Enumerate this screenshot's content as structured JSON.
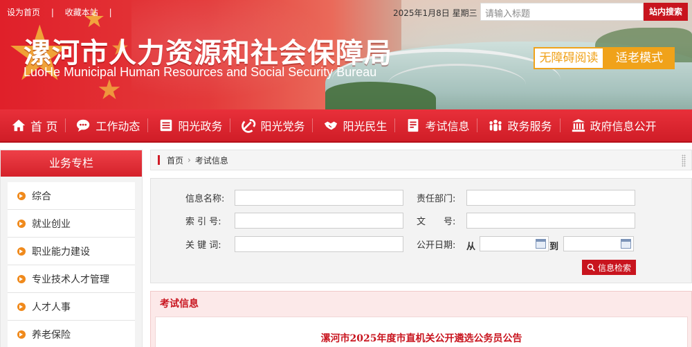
{
  "header": {
    "links": [
      "设为首页",
      "收藏本站"
    ],
    "date": "2025年1月8日 星期三",
    "search_placeholder": "请输入标题",
    "search_button": "站内搜索",
    "title_cn": "漯河市人力资源和社会保障局",
    "title_en": "LuoHe Municipal Human Resources and Social Security Bureau",
    "accessibility_button": "无障碍阅读",
    "elder_mode_button": "适老模式"
  },
  "nav": [
    {
      "label": "首 页",
      "icon": "home-icon"
    },
    {
      "label": "工作动态",
      "icon": "chat-icon"
    },
    {
      "label": "阳光政务",
      "icon": "list-icon"
    },
    {
      "label": "阳光党务",
      "icon": "party-icon"
    },
    {
      "label": "阳光民生",
      "icon": "handshake-icon"
    },
    {
      "label": "考试信息",
      "icon": "document-icon"
    },
    {
      "label": "政务服务",
      "icon": "people-icon"
    },
    {
      "label": "政府信息公开",
      "icon": "building-icon"
    }
  ],
  "sidebar": {
    "title": "业务专栏",
    "items": [
      "综合",
      "就业创业",
      "职业能力建设",
      "专业技术人才管理",
      "人才人事",
      "养老保险"
    ]
  },
  "breadcrumb": {
    "home": "首页",
    "current": "考试信息"
  },
  "form": {
    "name_label": "信息名称:",
    "dept_label": "责任部门:",
    "index_label": "索 引 号:",
    "doc_label": "文　　号:",
    "keyword_label": "关 键 词:",
    "date_label": "公开日期:",
    "from_label": "从",
    "to_label": "到",
    "submit": "信息检索"
  },
  "results": {
    "title": "考试信息",
    "items": [
      "漯河市2025年度市直机关公开遴选公务员公告"
    ]
  },
  "colors": {
    "primary_red": "#d01d27",
    "accent_orange": "#f0a21a"
  }
}
